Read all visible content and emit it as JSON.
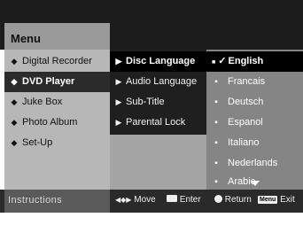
{
  "header": {
    "title": "Menu"
  },
  "main_menu": {
    "items": [
      {
        "label": "Digital Recorder",
        "selected": false
      },
      {
        "label": "DVD Player",
        "selected": true
      },
      {
        "label": "Juke Box",
        "selected": false
      },
      {
        "label": "Photo Album",
        "selected": false
      },
      {
        "label": "Set-Up",
        "selected": false
      }
    ]
  },
  "sub_menu": {
    "items": [
      {
        "label": "Disc Language",
        "selected": true
      },
      {
        "label": "Audio Language",
        "selected": false
      },
      {
        "label": "Sub-Title",
        "selected": false
      },
      {
        "label": "Parental Lock",
        "selected": false
      }
    ]
  },
  "options": {
    "items": [
      {
        "label": "English",
        "checked": true
      },
      {
        "label": "Francais",
        "checked": false
      },
      {
        "label": "Deutsch",
        "checked": false
      },
      {
        "label": "Espanol",
        "checked": false
      },
      {
        "label": "Italiano",
        "checked": false
      },
      {
        "label": "Nederlands",
        "checked": false
      },
      {
        "label": "Arabic",
        "checked": false
      }
    ],
    "check_glyph": "✓",
    "more_indicator": "▼"
  },
  "footer": {
    "instructions_label": "Instructions",
    "move_label": "Move",
    "enter_label": "Enter",
    "return_label": "Return",
    "menu_key": "Menu",
    "exit_label": "Exit"
  }
}
